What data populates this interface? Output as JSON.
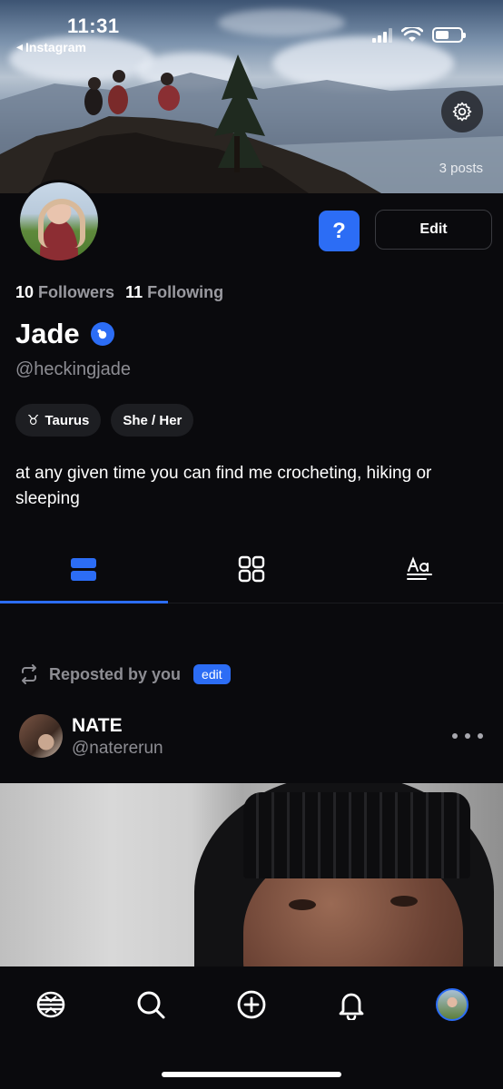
{
  "status_bar": {
    "time": "11:31",
    "back_label": "Instagram"
  },
  "header": {
    "posts_count": "3 posts",
    "settings_icon": "gear-icon"
  },
  "profile": {
    "help_label": "?",
    "edit_label": "Edit",
    "followers_count": "10",
    "followers_label": "Followers",
    "following_count": "11",
    "following_label": "Following",
    "name": "Jade",
    "handle": "@heckingjade",
    "chips": [
      {
        "icon": "taurus-icon",
        "label": "Taurus"
      },
      {
        "label": "She / Her"
      }
    ],
    "bio": "at any given time you can find me crocheting, hiking or sleeping"
  },
  "tabs": [
    {
      "icon": "posts-list-icon",
      "active": true
    },
    {
      "icon": "grid-icon",
      "active": false
    },
    {
      "icon": "text-posts-icon",
      "active": false
    }
  ],
  "post": {
    "repost_label": "Reposted by you",
    "repost_edit_label": "edit",
    "author_name": "NATE",
    "author_handle": "@natererun"
  },
  "bottom_nav": [
    {
      "icon": "home-logo-icon"
    },
    {
      "icon": "search-icon"
    },
    {
      "icon": "create-post-icon"
    },
    {
      "icon": "notifications-bell-icon"
    },
    {
      "icon": "profile-avatar"
    }
  ],
  "colors": {
    "background": "#0a0a0d",
    "accent": "#2c6df5",
    "muted_text": "#8d8d93"
  }
}
